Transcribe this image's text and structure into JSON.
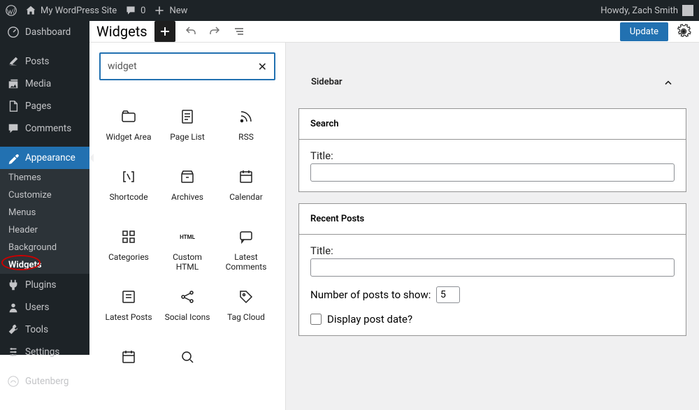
{
  "adminbar": {
    "site_name": "My WordPress Site",
    "comments": "0",
    "new": "New",
    "greeting": "Howdy, Zach Smith"
  },
  "sidebar": {
    "dashboard": "Dashboard",
    "posts": "Posts",
    "media": "Media",
    "pages": "Pages",
    "comments": "Comments",
    "appearance": "Appearance",
    "appearance_sub": {
      "themes": "Themes",
      "customize": "Customize",
      "menus": "Menus",
      "header": "Header",
      "background": "Background",
      "widgets": "Widgets"
    },
    "plugins": "Plugins",
    "users": "Users",
    "tools": "Tools",
    "settings": "Settings",
    "gutenberg": "Gutenberg"
  },
  "editor": {
    "title": "Widgets",
    "update": "Update"
  },
  "inserter": {
    "search_value": "widget",
    "blocks": [
      {
        "label": "Widget Area",
        "icon": "folder"
      },
      {
        "label": "Page List",
        "icon": "pagelist"
      },
      {
        "label": "RSS",
        "icon": "rss"
      },
      {
        "label": "Shortcode",
        "icon": "shortcode"
      },
      {
        "label": "Archives",
        "icon": "archives"
      },
      {
        "label": "Calendar",
        "icon": "calendar"
      },
      {
        "label": "Categories",
        "icon": "categories"
      },
      {
        "label": "Custom HTML",
        "icon": "html"
      },
      {
        "label": "Latest Comments",
        "icon": "comments"
      },
      {
        "label": "Latest Posts",
        "icon": "posts"
      },
      {
        "label": "Social Icons",
        "icon": "share"
      },
      {
        "label": "Tag Cloud",
        "icon": "tag"
      }
    ]
  },
  "canvas": {
    "area_title": "Sidebar",
    "search_widget": {
      "title": "Search",
      "label_title": "Title:"
    },
    "recent_widget": {
      "title": "Recent Posts",
      "label_title": "Title:",
      "label_count": "Number of posts to show:",
      "count_value": "5",
      "label_date": "Display post date?"
    }
  }
}
